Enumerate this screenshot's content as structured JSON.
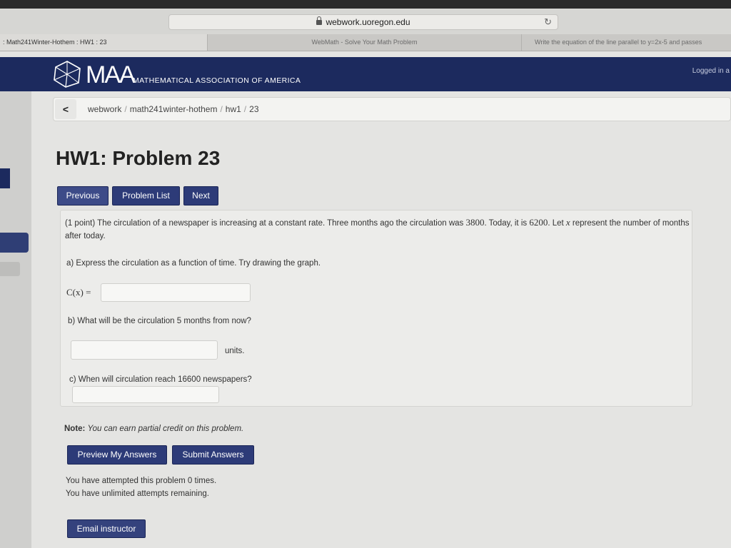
{
  "browser": {
    "url": "webwork.uoregon.edu",
    "tabs": [
      {
        "label": ": Math241Winter-Hothem : HW1 : 23"
      },
      {
        "label": "WebMath - Solve Your Math Problem"
      },
      {
        "label": "Write the equation of the line parallel to y=2x-5 and passes"
      }
    ]
  },
  "header": {
    "abbr": "MAA",
    "org_name": "MATHEMATICAL ASSOCIATION OF AMERICA",
    "logged_in": "Logged in a",
    "brand_color": "#1c2a5e"
  },
  "breadcrumb": {
    "back": "<",
    "items": [
      "webwork",
      "math241winter-hothem",
      "hw1",
      "23"
    ]
  },
  "page": {
    "title": "HW1: Problem 23",
    "nav": {
      "previous": "Previous",
      "problem_list": "Problem List",
      "next": "Next"
    }
  },
  "problem": {
    "intro_before": "(1 point) The circulation of a newspaper is increasing at a constant rate. Three months ago the circulation was ",
    "value_past": "3800",
    "intro_mid": ". Today, it is ",
    "value_today": "6200",
    "intro_mid2": ". Let ",
    "variable": "x",
    "intro_after": " represent the number of months after today.",
    "part_a": "a) Express the circulation as a function of time. Try drawing the graph.",
    "function_label": "C(x) =",
    "answer_a": "",
    "part_b": "b) What will be the circulation 5 months from now?",
    "answer_b": "",
    "units": "units.",
    "part_c": "c) When will circulation reach 16600 newspapers?",
    "answer_c": ""
  },
  "footer": {
    "note_label": "Note:",
    "note_text": "You can earn partial credit on this problem.",
    "preview_button": "Preview My Answers",
    "submit_button": "Submit Answers",
    "attempts_line1": "You have attempted this problem 0 times.",
    "attempts_line2": "You have unlimited attempts remaining.",
    "email_button": "Email instructor"
  }
}
